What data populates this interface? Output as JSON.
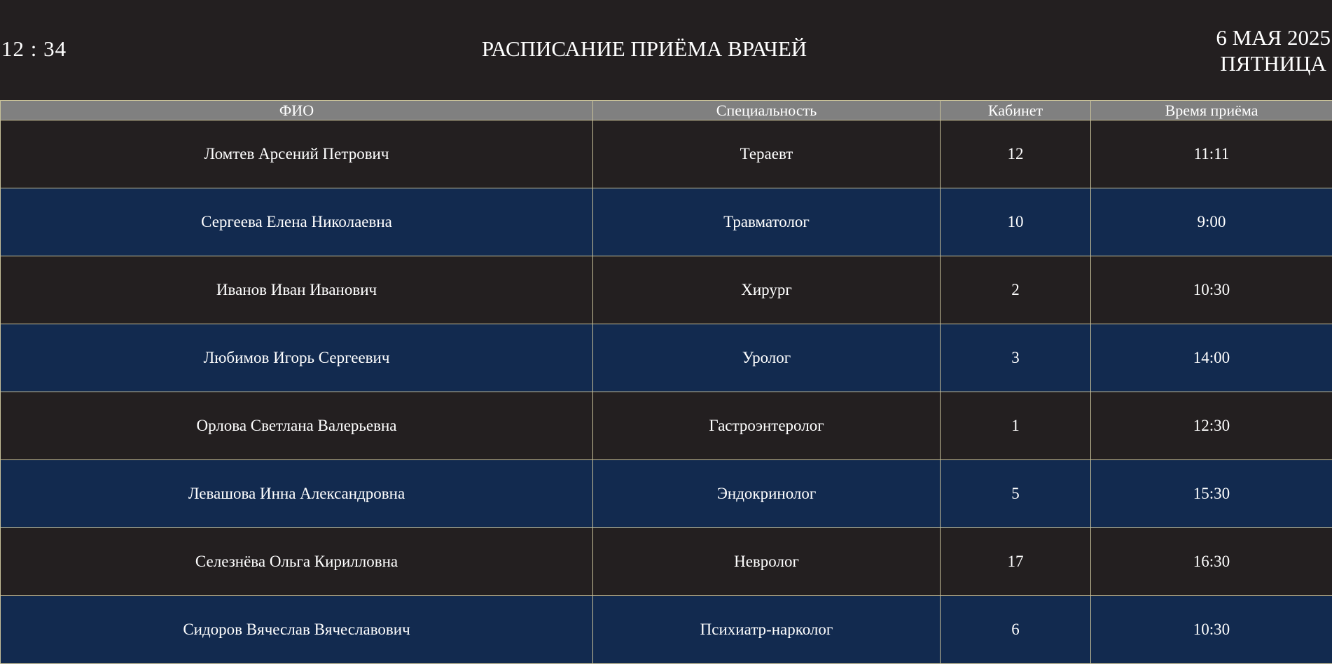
{
  "header": {
    "clock": "12 : 34",
    "title": "РАСПИСАНИЕ ПРИЁМА ВРАЧЕЙ",
    "date": "6 МАЯ 2025",
    "weekday": "ПЯТНИЦА"
  },
  "table": {
    "columns": [
      "ФИО",
      "Специальность",
      "Кабинет",
      "Время приёма"
    ],
    "rows": [
      {
        "name": "Ломтев Арсений Петрович",
        "specialty": "Тераевт",
        "room": "12",
        "time": "11:11"
      },
      {
        "name": "Сергеева Елена Николаевна",
        "specialty": "Травматолог",
        "room": "10",
        "time": "9:00"
      },
      {
        "name": "Иванов Иван Иванович",
        "specialty": "Хирург",
        "room": "2",
        "time": "10:30"
      },
      {
        "name": "Любимов Игорь Сергеевич",
        "specialty": "Уролог",
        "room": "3",
        "time": "14:00"
      },
      {
        "name": "Орлова Светлана Валерьевна",
        "specialty": "Гастроэнтеролог",
        "room": "1",
        "time": "12:30"
      },
      {
        "name": "Левашова Инна Александровна",
        "specialty": "Эндокринолог",
        "room": "5",
        "time": "15:30"
      },
      {
        "name": "Селезнёва Ольга Кирилловна",
        "specialty": "Невролог",
        "room": "17",
        "time": "16:30"
      },
      {
        "name": "Сидоров Вячеслав Вячеславович",
        "specialty": "Психиатр-нарколог",
        "room": "6",
        "time": "10:30"
      }
    ]
  },
  "colors": {
    "background": "#231f20",
    "row_alt": "#122a4f",
    "header_row": "#808080",
    "grid": "#c9c29a"
  }
}
